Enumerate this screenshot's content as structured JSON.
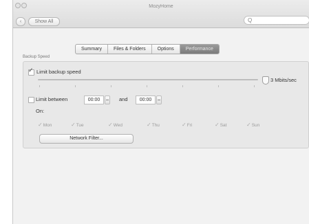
{
  "window": {
    "title": "MozyHome"
  },
  "toolbar": {
    "show_all_label": "Show All",
    "back_label": "‹"
  },
  "search": {
    "icon": "search-icon",
    "glyph": "Q"
  },
  "tabs": [
    {
      "label": "Summary",
      "active": false
    },
    {
      "label": "Files & Folders",
      "active": false
    },
    {
      "label": "Options",
      "active": false
    },
    {
      "label": "Performance",
      "active": true
    }
  ],
  "backup_speed": {
    "group_label": "Backup Speed",
    "limit_speed": {
      "label": "Limit backup speed",
      "checked": true
    },
    "slider": {
      "value_label": "3 Mbits/sec",
      "level": 1.0
    },
    "limit_between": {
      "label": "Limit between",
      "checked": false,
      "start": "00:00",
      "and_label": "and",
      "end": "00:00"
    },
    "on_label": "On:",
    "days": [
      {
        "label": "Mon",
        "checked": true
      },
      {
        "label": "Tue",
        "checked": true
      },
      {
        "label": "Wed",
        "checked": true
      },
      {
        "label": "Thu",
        "checked": true
      },
      {
        "label": "Fri",
        "checked": true
      },
      {
        "label": "Sat",
        "checked": true
      },
      {
        "label": "Sun",
        "checked": true
      }
    ],
    "network_filter_label": "Network Filter..."
  }
}
